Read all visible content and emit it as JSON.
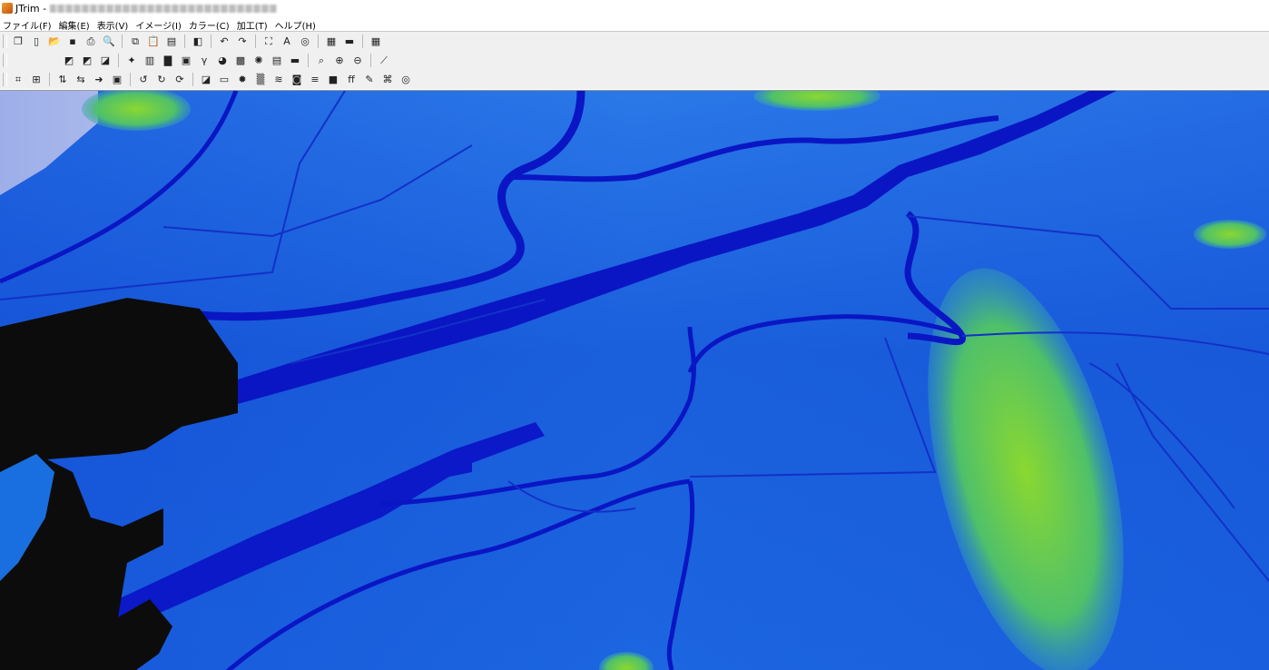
{
  "window": {
    "title": "JTrim - "
  },
  "menu": [
    "ファイル(F)",
    "編集(E)",
    "表示(V)",
    "イメージ(I)",
    "カラー(C)",
    "加工(T)",
    "ヘルプ(H)"
  ],
  "toolbar_rows": [
    [
      "new-window",
      "new",
      "open",
      "save",
      "print",
      "print-preview",
      "|",
      "copy",
      "paste",
      "paste-new",
      "|",
      "scan",
      "|",
      "undo",
      "redo",
      "|",
      "fit",
      "text",
      "pick",
      "|",
      "tile",
      "strip",
      "|",
      "grid-view"
    ],
    [
      "spacer",
      "grayscale",
      "sepia",
      "invert",
      "|",
      "auto-level",
      "gradient",
      "histogram",
      "image-stats",
      "gamma",
      "color-balance",
      "mosaic-color",
      "rgb",
      "hsv",
      "monochrome",
      "|",
      "zoom",
      "zoom-in",
      "zoom-out",
      "|",
      "eyedropper"
    ],
    [
      "crop",
      "resize",
      "|",
      "flip-v",
      "flip-h",
      "rotate-arrow",
      "frame",
      "|",
      "rotate-left",
      "rotate-right",
      "rotate-custom",
      "|",
      "shadow",
      "emboss",
      "blur",
      "noise",
      "wave",
      "stamp",
      "lines",
      "square",
      "filter-ff",
      "pen",
      "brush",
      "spiral"
    ]
  ],
  "colors": {
    "toolbar_bg": "#f0f0f0",
    "terrain_low": "#0a14c0",
    "terrain_mid": "#1d6be0",
    "terrain_high": "#7fcf3a",
    "water_black": "#0c0c0c",
    "sky": "#eaeaf6"
  }
}
